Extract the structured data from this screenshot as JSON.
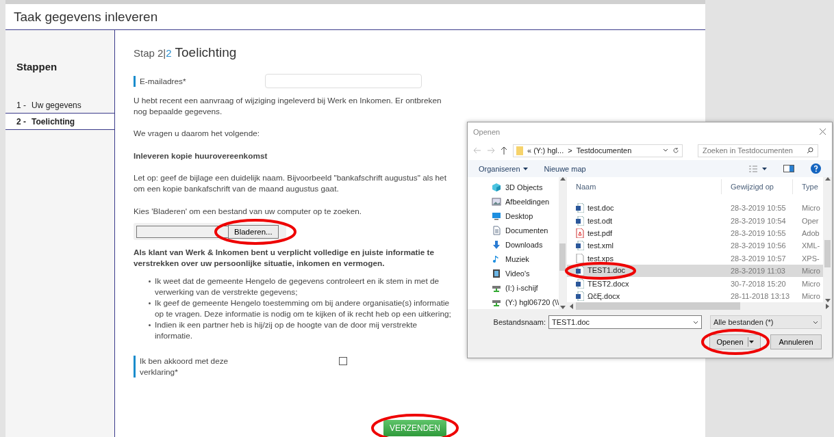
{
  "page": {
    "title": "Taak gegevens inleveren"
  },
  "sidebar": {
    "heading": "Stappen",
    "steps": [
      {
        "number": "1 -",
        "label": "Uw gegevens",
        "selected": false
      },
      {
        "number": "2 -",
        "label": "Toelichting",
        "selected": true
      }
    ]
  },
  "main": {
    "step_label": "Stap 2|",
    "step_number": "2",
    "heading": "Toelichting",
    "blocks": [
      {
        "kind": "field",
        "label": "E-mailadres*"
      },
      {
        "kind": "text",
        "text": "U hebt recent een aanvraag of wijziging ingeleverd bij Werk en Inkomen. Er ontbreken nog bepaalde gegevens."
      },
      {
        "kind": "text",
        "text": "We vragen u daarom het volgende:"
      },
      {
        "kind": "bold",
        "text": "Inleveren kopie huurovereenkomst"
      },
      {
        "kind": "text",
        "text": "Let op: geef de bijlage een duidelijk naam. Bijvoorbeeld \"bankafschrift augustus\" als het om een kopie bankafschrift van de maand augustus gaat."
      },
      {
        "kind": "text",
        "text": "Kies 'Bladeren' om een bestand van uw computer op te zoeken."
      },
      {
        "kind": "file",
        "button": "Bladeren..."
      },
      {
        "kind": "bold",
        "text": "Als klant van Werk & Inkomen bent u verplicht volledige en juiste informatie te verstrekken over uw persoonlijke situatie, inkomen en vermogen."
      },
      {
        "kind": "bullets",
        "items": [
          "Ik weet dat de gemeente Hengelo de gegevens controleert en ik stem in met de verwerking van de verstrekte gegevens;",
          "Ik geef de gemeente Hengelo toestemming om bij andere organisatie(s) informatie op te vragen. Deze informatie is nodig om te kijken of ik recht heb op een uitkering;",
          "Indien ik een partner heb is hij/zij op de hoogte van de door mij verstrekte informatie."
        ]
      },
      {
        "kind": "checkbox",
        "label": "Ik ben akkoord met deze verklaring*",
        "checked": false
      }
    ],
    "submit": "VERZENDEN"
  },
  "dialog": {
    "title": "Openen",
    "path_prefix": "«  (Y:) hgl...",
    "path_separator": ">",
    "path_current": "Testdocumenten",
    "search_placeholder": "Zoeken in Testdocumenten",
    "toolbar": {
      "organize": "Organiseren",
      "new_folder": "Nieuwe map"
    },
    "nav_items": [
      {
        "label": "3D Objects",
        "kind": "cube"
      },
      {
        "label": "Afbeeldingen",
        "kind": "pictures"
      },
      {
        "label": "Desktop",
        "kind": "desktop"
      },
      {
        "label": "Documenten",
        "kind": "document"
      },
      {
        "label": "Downloads",
        "kind": "download"
      },
      {
        "label": "Muziek",
        "kind": "music"
      },
      {
        "label": "Video's",
        "kind": "video"
      },
      {
        "label": "(I:) i-schijf",
        "kind": "drive"
      },
      {
        "label": "(Y:) hgl06720 (\\\\",
        "kind": "drive"
      }
    ],
    "columns": [
      "Naam",
      "Gewijzigd op",
      "Type"
    ],
    "files": [
      {
        "name": "test.doc",
        "date": "28-3-2019 10:55",
        "type": "Micro",
        "kind": "word",
        "selected": false
      },
      {
        "name": "test.odt",
        "date": "28-3-2019 10:54",
        "type": "Oper",
        "kind": "word",
        "selected": false
      },
      {
        "name": "test.pdf",
        "date": "28-3-2019 10:55",
        "type": "Adob",
        "kind": "pdf",
        "selected": false
      },
      {
        "name": "test.xml",
        "date": "28-3-2019 10:56",
        "type": "XML-",
        "kind": "word",
        "selected": false
      },
      {
        "name": "test.xps",
        "date": "28-3-2019 10:57",
        "type": "XPS-",
        "kind": "blank",
        "selected": false
      },
      {
        "name": "TEST1.doc",
        "date": "28-3-2019 11:03",
        "type": "Micro",
        "kind": "word",
        "selected": true
      },
      {
        "name": "TEST2.docx",
        "date": "30-7-2018 15:20",
        "type": "Micro",
        "kind": "word",
        "selected": false
      },
      {
        "name": "ΩčĘ.docx",
        "date": "28-11-2018 13:13",
        "type": "Micro",
        "kind": "word",
        "selected": false
      }
    ],
    "filename_label": "Bestandsnaam:",
    "filename": "TEST1.doc",
    "filter": "Alle bestanden (*)",
    "open_button": "Openen",
    "cancel_button": "Annuleren"
  }
}
